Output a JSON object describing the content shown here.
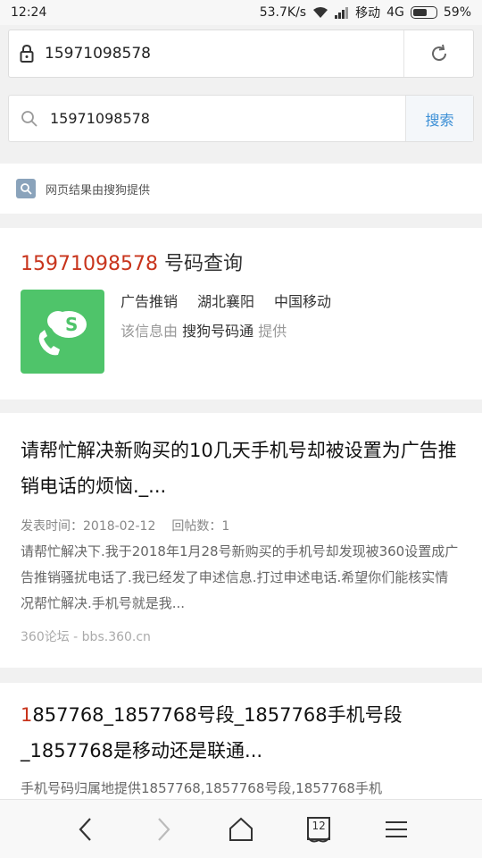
{
  "status_bar": {
    "time": "12:24",
    "speed": "53.7K/s",
    "carrier": "移动",
    "network": "4G",
    "battery": "59%"
  },
  "url_bar": {
    "url": "15971098578",
    "icons": {
      "lock": "lock-icon",
      "refresh": "refresh-icon"
    }
  },
  "search": {
    "query": "15971098578",
    "button_label": "搜索"
  },
  "provider_note": "网页结果由搜狗提供",
  "phone_card": {
    "number": "15971098578",
    "title_suffix": " 号码查询",
    "category": "广告推销",
    "location": "湖北襄阳",
    "carrier": "中国移动",
    "info_prefix": "该信息由 ",
    "info_source": "搜狗号码通",
    "info_suffix": " 提供",
    "accent_color": "#c8341c"
  },
  "results": [
    {
      "title": "请帮忙解决新购买的10几天手机号却被设置为广告推销电话的烦恼._...",
      "post_time": "发表时间：2018-02-12",
      "reply_count": "回帖数：1",
      "snippet": "请帮忙解决下.我于2018年1月28号新购买的手机号却发现被360设置成广告推销骚扰电话了.我已经发了申述信息.打过申述电话.希望你们能核实情况帮忙解决.手机号就是我...",
      "site": "360论坛 - bbs.360.cn"
    },
    {
      "title_first": "1",
      "title_rest": "857768_1857768号段_1857768手机号段_1857768是移动还是联通...",
      "snippet": "手机号码归属地提供1857768,1857768号段,1857768手机"
    }
  ],
  "bottom_nav": {
    "tab_count": "12"
  }
}
